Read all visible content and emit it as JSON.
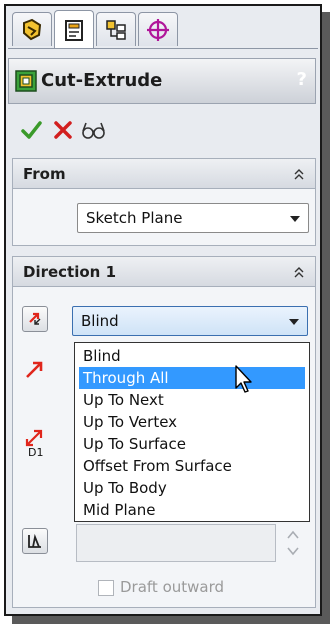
{
  "tabs": [
    {
      "name": "featuremanager",
      "icon": "feature-manager-icon"
    },
    {
      "name": "propertymanager",
      "icon": "property-manager-icon"
    },
    {
      "name": "configurationmanager",
      "icon": "configuration-manager-icon"
    },
    {
      "name": "dimxpertmanager",
      "icon": "dimxpert-manager-icon"
    }
  ],
  "header": {
    "title": "Cut-Extrude",
    "help": "?"
  },
  "actions": {
    "ok": "ok-check-icon",
    "cancel": "cancel-x-icon",
    "preview": "detailed-preview-icon"
  },
  "from": {
    "label": "From",
    "value": "Sketch Plane"
  },
  "direction1": {
    "label": "Direction 1",
    "end_condition": "Blind",
    "options": [
      "Blind",
      "Through All",
      "Up To Next",
      "Up To Vertex",
      "Up To Surface",
      "Offset From Surface",
      "Up To Body",
      "Mid Plane"
    ],
    "highlighted_option": "Through All",
    "depth_label": "D1",
    "draft_outward": "Draft outward"
  },
  "colors": {
    "accent": "#3399ff",
    "arrow": "#e0261c",
    "ok": "#3a9a2a"
  }
}
